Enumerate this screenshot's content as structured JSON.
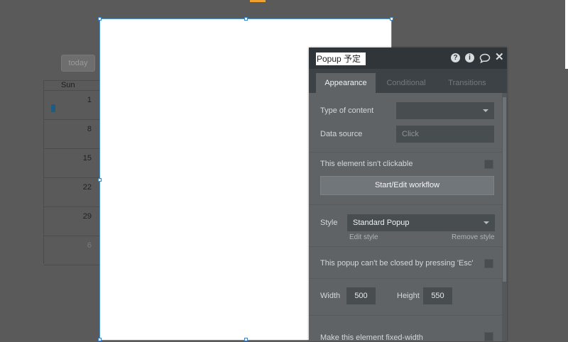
{
  "calendar": {
    "today_label": "today",
    "day_header": "Sun",
    "rows": [
      "1",
      "8",
      "15",
      "22",
      "29",
      "6"
    ]
  },
  "panel": {
    "title": "Popup 予定",
    "header_icons": [
      "help-icon",
      "info-icon",
      "comment-icon",
      "close-icon"
    ],
    "tabs": [
      "Appearance",
      "Conditional",
      "Transitions"
    ],
    "active_tab": "Appearance",
    "type_of_content_label": "Type of content",
    "type_of_content_value": "",
    "data_source_label": "Data source",
    "data_source_placeholder": "Click",
    "not_clickable_label": "This element isn't clickable",
    "workflow_button": "Start/Edit workflow",
    "style_label": "Style",
    "style_value": "Standard Popup",
    "edit_style": "Edit style",
    "remove_style": "Remove style",
    "esc_label": "This popup can't be closed by pressing 'Esc'",
    "width_label": "Width",
    "width_value": "500",
    "height_label": "Height",
    "height_value": "550",
    "fixed_width_label": "Make this element fixed-width"
  },
  "colors": {
    "panel_bg": "#5f6366",
    "header_bg": "#2f3539",
    "tabbar_bg": "#3c4246",
    "input_bg": "#484d50",
    "selection": "#4a90c8"
  }
}
